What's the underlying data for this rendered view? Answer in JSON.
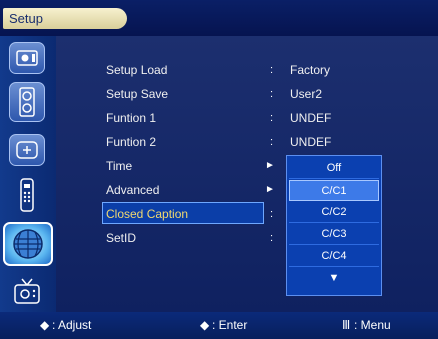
{
  "title": {
    "tab": "Setup"
  },
  "sidebar": {
    "icons": [
      "picture-icon",
      "speaker-icon",
      "setup-icon",
      "remote-icon",
      "globe-icon",
      "tv-icon"
    ],
    "active_index": 4
  },
  "menu": {
    "items": [
      {
        "label": "Setup Load",
        "sep": ":",
        "value": "Factory"
      },
      {
        "label": "Setup Save",
        "sep": ":",
        "value": "User2"
      },
      {
        "label": "Funtion 1",
        "sep": ":",
        "value": "UNDEF"
      },
      {
        "label": "Funtion 2",
        "sep": ":",
        "value": "UNDEF"
      },
      {
        "label": "Time",
        "sep": "►",
        "value": ""
      },
      {
        "label": "Advanced",
        "sep": "►",
        "value": ""
      },
      {
        "label": "Closed Caption",
        "sep": ":",
        "value": ""
      },
      {
        "label": "SetID",
        "sep": ":",
        "value": ""
      }
    ],
    "active_index": 6
  },
  "dropdown": {
    "options": [
      "Off",
      "C/C1",
      "C/C2",
      "C/C3",
      "C/C4"
    ],
    "selected_index": 1,
    "more_icon": "▼"
  },
  "footer": {
    "adjust_icon": "◆",
    "adjust": ": Adjust",
    "enter_icon": "◆",
    "enter": ": Enter",
    "menu_icon": "Ⅲ",
    "menu": ": Menu"
  },
  "colors": {
    "background": "#0c1a4c",
    "accent": "#3d7ae8",
    "tab": "#f7f1cf"
  }
}
